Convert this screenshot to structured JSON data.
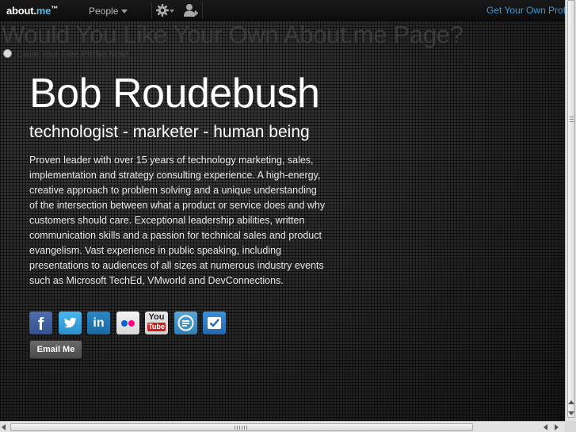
{
  "topbar": {
    "logo_text": "about.",
    "logo_accent": "me",
    "logo_tm": "™",
    "people_label": "People",
    "settings_icon": "gear-icon",
    "profile_icon": "add-user-icon",
    "get_own_profile_label": "Get Your Own Profile"
  },
  "banner": {
    "title": "Would You Like Your Own About.me Page?",
    "claim_label": "Claim Your Free Profile Now!"
  },
  "profile": {
    "name": "Bob Roudebush",
    "headline": "technologist - marketer - human being",
    "bio_lines": [
      "Proven leader with over 15 years of technology marketing, sales,",
      "implementation and strategy consulting experience.  A high-energy,",
      "creative approach to problem solving and a unique understanding",
      "of the intersection between what a product or service does and why",
      "customers should care.  Exceptional leadership abilities, written",
      "communication skills and a passion for technical sales and product",
      "evangelism.  Vast experience in public speaking, including",
      "presentations to audiences of all sizes at numerous industry events",
      "such as Microsoft TechEd, VMworld and DevConnections."
    ],
    "social_links": [
      {
        "name": "facebook",
        "icon": "facebook-icon",
        "glyph": "f"
      },
      {
        "name": "twitter",
        "icon": "twitter-icon"
      },
      {
        "name": "linkedin",
        "icon": "linkedin-icon",
        "glyph": "in"
      },
      {
        "name": "flickr",
        "icon": "flickr-icon"
      },
      {
        "name": "youtube",
        "icon": "youtube-icon",
        "glyph_top": "You",
        "glyph_bottom": "Tube"
      },
      {
        "name": "expensify",
        "icon": "expensify-icon"
      },
      {
        "name": "foursquare",
        "icon": "foursquare-icon"
      }
    ],
    "email_button_label": "Email Me"
  },
  "colors": {
    "accent_link": "#3d9ad6",
    "logo_me": "#58b8e8",
    "facebook": "#3b5998",
    "twitter": "#33aaf0",
    "linkedin": "#1f78b4",
    "flickr_blue": "#0063dc",
    "flickr_pink": "#ff0084",
    "youtube_red": "#cc1f1f"
  }
}
